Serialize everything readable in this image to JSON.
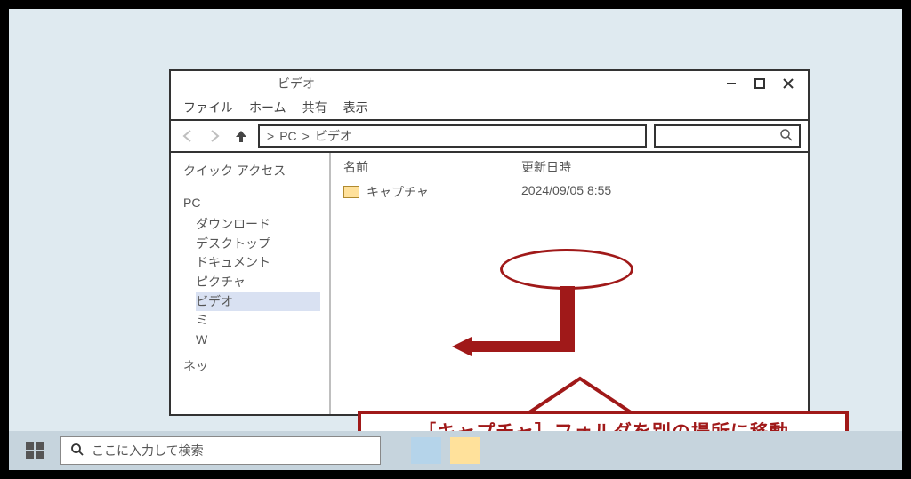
{
  "window": {
    "title": "ビデオ",
    "menu": {
      "file": "ファイル",
      "home": "ホーム",
      "share": "共有",
      "view": "表示"
    },
    "path": {
      "sep1": ">",
      "seg1": "PC",
      "sep2": ">",
      "seg2": "ビデオ"
    },
    "search_placeholder": ""
  },
  "sidebar": {
    "quick_access": "クイック アクセス",
    "pc": "PC",
    "items": {
      "downloads": "ダウンロード",
      "desktop": "デスクトップ",
      "documents": "ドキュメント",
      "pictures": "ピクチャ",
      "videos": "ビデオ",
      "music": "ミ",
      "w": "W"
    },
    "network": "ネッ"
  },
  "columns": {
    "name": "名前",
    "modified": "更新日時"
  },
  "rows": [
    {
      "name": "キャプチャ",
      "modified": "2024/09/05 8:55"
    }
  ],
  "annotation": {
    "note": "［キャプチャ］フォルダを別の場所に移動"
  },
  "taskbar": {
    "search_placeholder": "ここに入力して検索"
  }
}
